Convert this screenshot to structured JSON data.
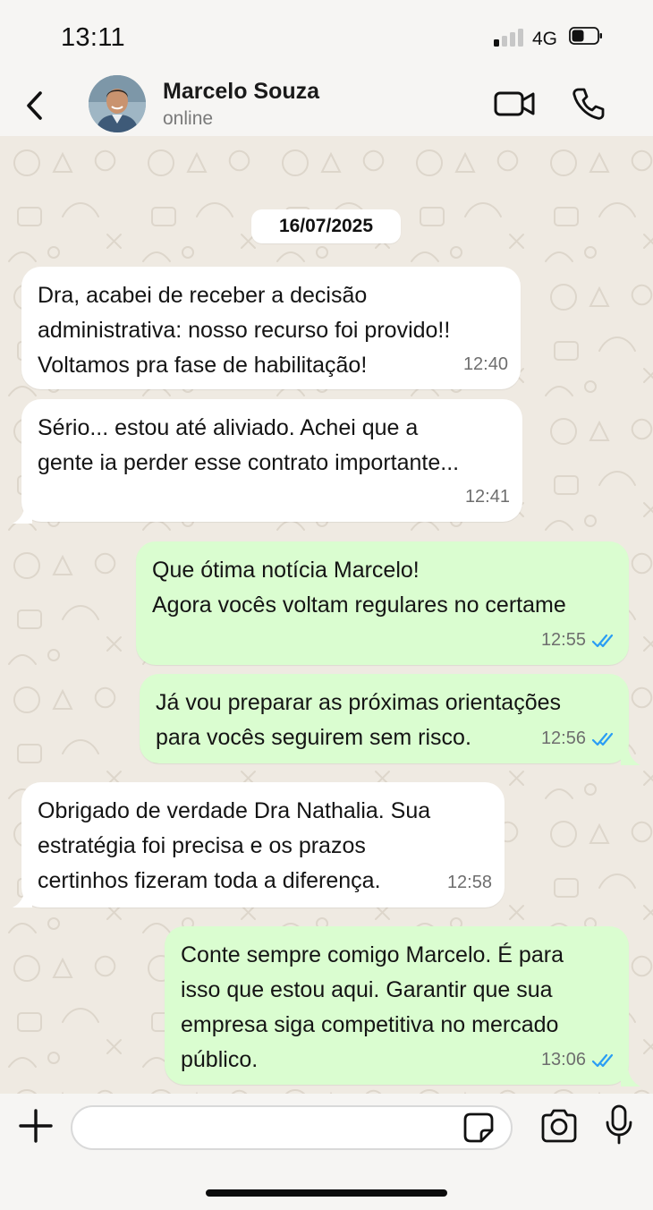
{
  "status_bar": {
    "time": "13:11",
    "network": "4G",
    "signal_bars_active": 1,
    "battery_level": 0.25
  },
  "header": {
    "back_icon": "chevron-left-icon",
    "contact_name": "Marcelo Souza",
    "contact_status": "online",
    "video_icon": "video-camera-icon",
    "call_icon": "phone-icon"
  },
  "chat": {
    "date_separator": "16/07/2025",
    "messages": [
      {
        "direction": "in",
        "text": "Dra, acabei de receber a decisão\nadministrativa: nosso recurso foi provido!!\nVoltamos pra fase de habilitação!",
        "time": "12:40"
      },
      {
        "direction": "in",
        "text": "Sério... estou até aliviado. Achei que a\ngente ia perder esse contrato importante...",
        "time": "12:41"
      },
      {
        "direction": "out",
        "text": "Que ótima notícia Marcelo!\nAgora vocês voltam regulares no certame",
        "time": "12:55",
        "status": "read"
      },
      {
        "direction": "out",
        "text": "Já vou preparar as próximas orientações\npara vocês seguirem sem risco.",
        "time": "12:56",
        "status": "read"
      },
      {
        "direction": "in",
        "text": "Obrigado de verdade Dra Nathalia. Sua\nestratégia foi precisa e os prazos\ncertinhos fizeram toda a diferença.",
        "time": "12:58"
      },
      {
        "direction": "out",
        "text": "Conte sempre comigo Marcelo. É para\nisso que estou aqui. Garantir que sua\nempresa siga competitiva no mercado\npúblico.",
        "time": "13:06",
        "status": "read"
      }
    ]
  },
  "composer": {
    "input_value": "",
    "attach_icon": "plus-icon",
    "sticker_icon": "sticker-icon",
    "camera_icon": "camera-icon",
    "mic_icon": "microphone-icon"
  },
  "colors": {
    "incoming_bubble": "#ffffff",
    "outgoing_bubble": "#dafdd0",
    "read_ticks": "#2a9df4",
    "chat_background": "#efeae2"
  }
}
